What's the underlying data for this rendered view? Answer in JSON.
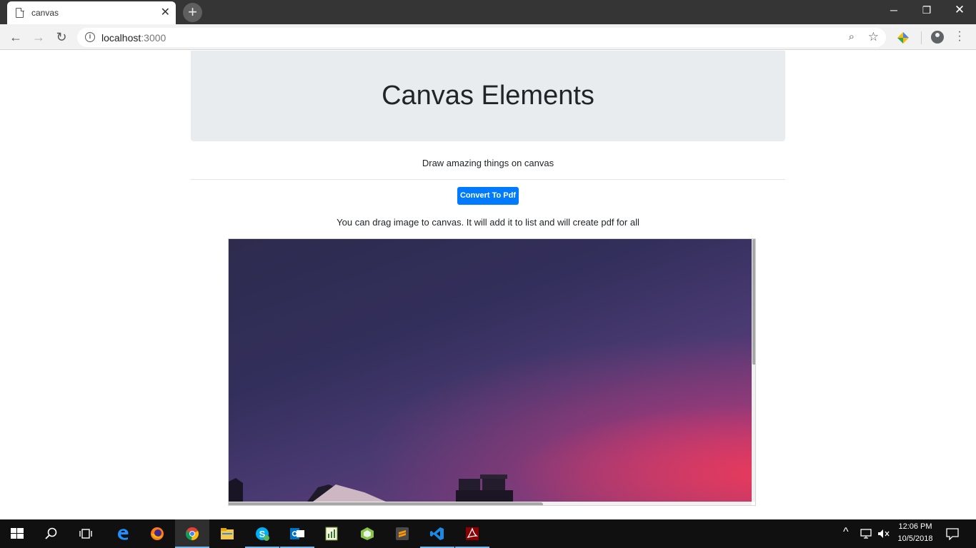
{
  "browser": {
    "tab_title": "canvas",
    "url_host": "localhost",
    "url_port": ":3000"
  },
  "page": {
    "heading": "Canvas Elements",
    "lead": "Draw amazing things on canvas",
    "convert_button": "Convert To Pdf",
    "hint": "You can drag image to canvas. It will add it to list and will create pdf for all"
  },
  "taskbar": {
    "apps": [
      "start-icon",
      "search-icon",
      "task-view-icon",
      "edge-icon",
      "firefox-icon",
      "chrome-icon",
      "file-explorer-icon",
      "skype-icon",
      "outlook-icon",
      "spreadsheet-icon",
      "app-icon",
      "sublime-text-icon",
      "vscode-icon",
      "acrobat-icon"
    ],
    "time": "12:06 PM",
    "date": "10/5/2018"
  },
  "colors": {
    "accent": "#007bff",
    "jumbotron": "#e9ecef",
    "taskbar": "#101010"
  }
}
